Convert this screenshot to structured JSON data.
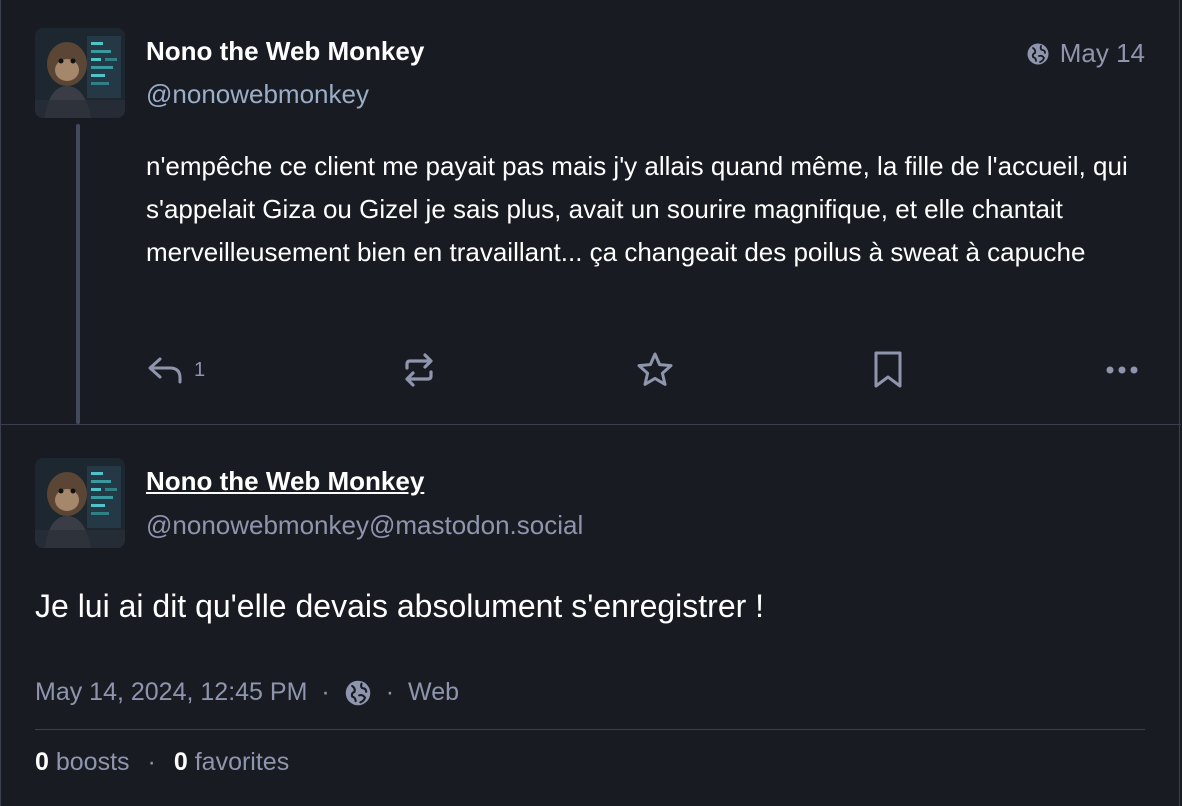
{
  "parent_post": {
    "display_name": "Nono the Web Monkey",
    "handle": "@nonowebmonkey",
    "visibility_icon": "globe-icon",
    "date": "May 14",
    "content": "n'empêche ce client me payait pas mais j'y allais quand même, la fille de l'accueil, qui s'appelait Giza ou Gizel je sais plus, avait un sourire magnifique, et elle chantait merveilleusement bien en travaillant... ça changeait des poilus à sweat à capuche",
    "actions": {
      "reply_count": "1",
      "reply_icon": "reply-icon",
      "boost_icon": "boost-icon",
      "favorite_icon": "star-icon",
      "bookmark_icon": "bookmark-icon",
      "more_icon": "more-icon"
    }
  },
  "focused_post": {
    "display_name": "Nono the Web Monkey",
    "handle": "@nonowebmonkey@mastodon.social",
    "content": "Je lui ai dit qu'elle devais absolument s'enregistrer !",
    "timestamp": "May 14, 2024, 12:45 PM",
    "separator": "·",
    "visibility_icon": "globe-icon",
    "application": "Web",
    "boosts_count": "0",
    "boosts_label": "boosts",
    "favorites_count": "0",
    "favorites_label": "favorites"
  },
  "colors": {
    "background": "#191b22",
    "border": "#393f4f",
    "muted_text": "#8e95ad",
    "primary_text": "#ffffff"
  }
}
